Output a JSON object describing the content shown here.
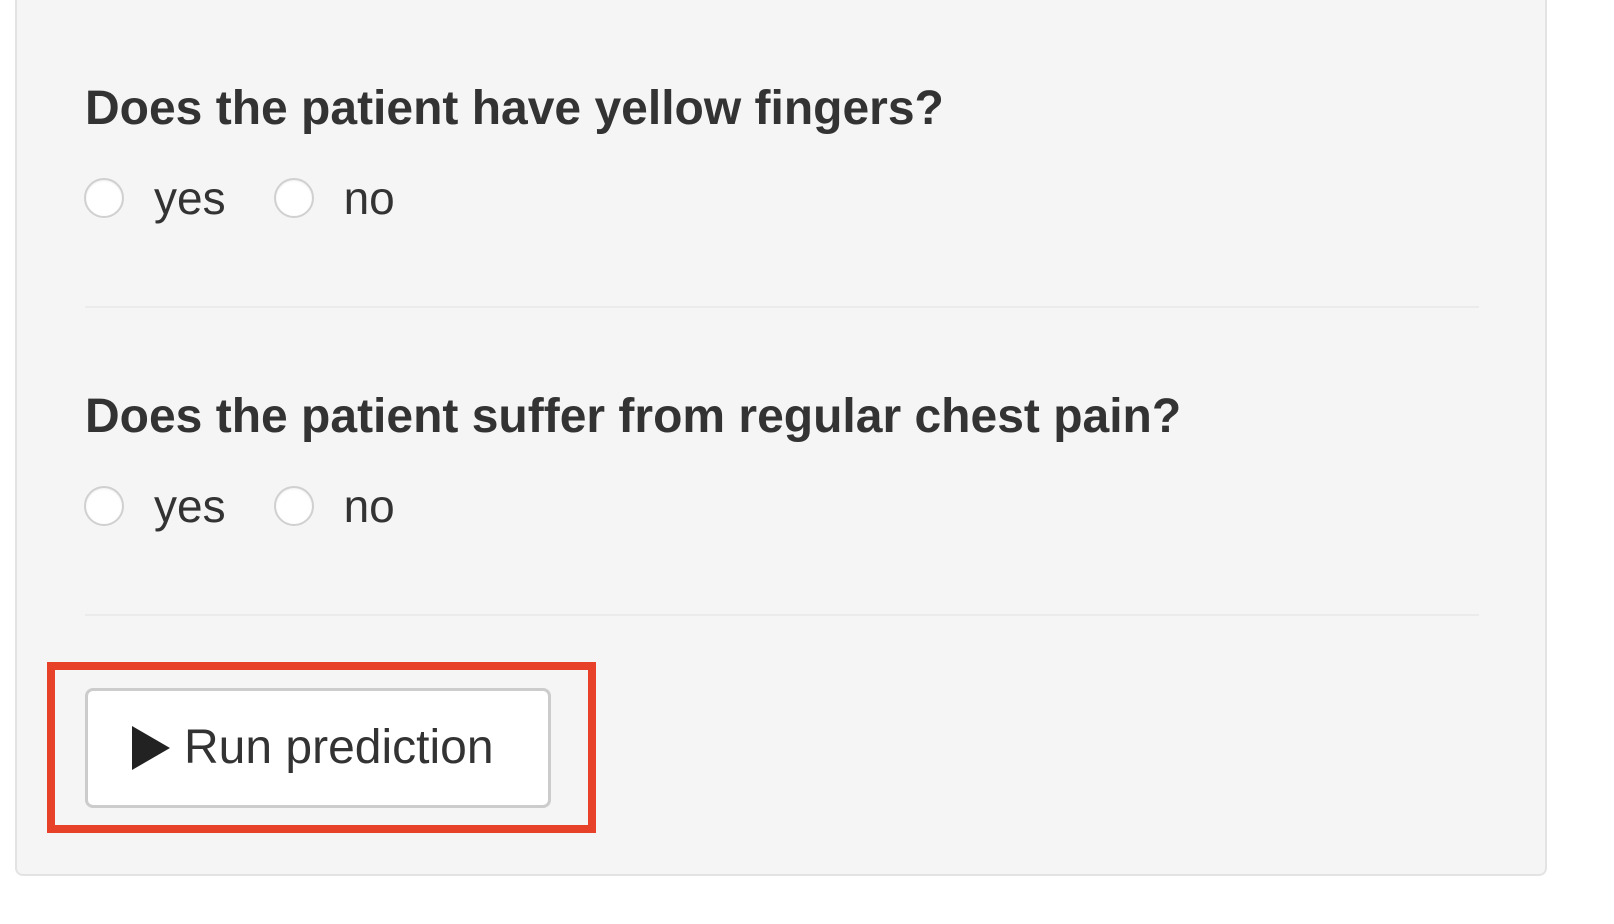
{
  "questions": [
    {
      "text": "Does the patient have yellow fingers?",
      "options": [
        "yes",
        "no"
      ],
      "selected": null
    },
    {
      "text": "Does the patient suffer from regular chest pain?",
      "options": [
        "yes",
        "no"
      ],
      "selected": null
    }
  ],
  "run_button": {
    "label": "Run prediction",
    "icon": "play-icon"
  },
  "colors": {
    "panel_background": "#f5f5f5",
    "text": "#333333",
    "highlight_border": "#e8412a",
    "button_border": "#cccccc"
  }
}
